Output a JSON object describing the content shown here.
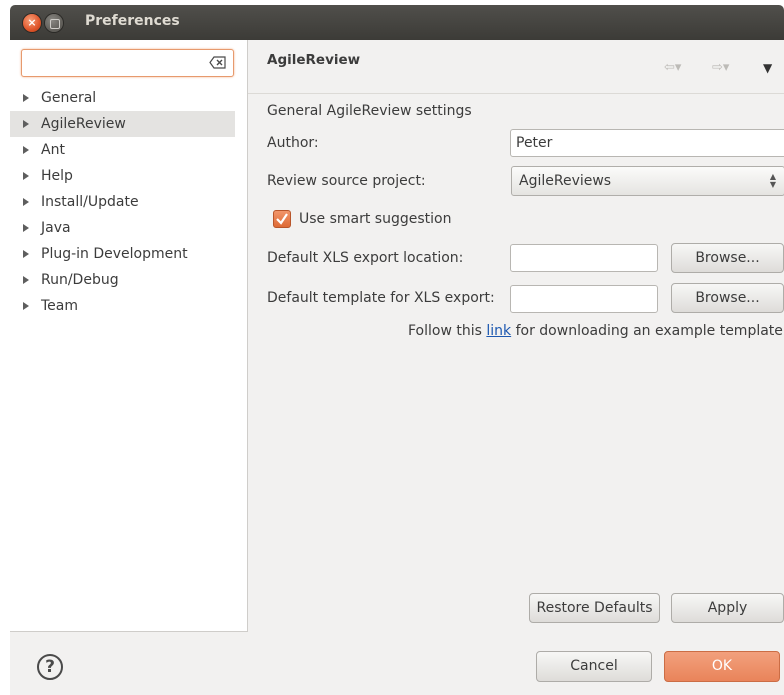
{
  "window": {
    "title": "Preferences"
  },
  "sidebar": {
    "filter_placeholder": "",
    "items": [
      {
        "label": "General"
      },
      {
        "label": "AgileReview"
      },
      {
        "label": "Ant"
      },
      {
        "label": "Help"
      },
      {
        "label": "Install/Update"
      },
      {
        "label": "Java"
      },
      {
        "label": "Plug-in Development"
      },
      {
        "label": "Run/Debug"
      },
      {
        "label": "Team"
      }
    ],
    "selected": "AgileReview"
  },
  "page": {
    "title": "AgileReview",
    "section_label": "General AgileReview settings",
    "author_label": "Author:",
    "author_value": "Peter",
    "source_project_label": "Review source project:",
    "source_project_value": "AgileReviews",
    "smart_suggestion_label": "Use smart suggestion",
    "smart_suggestion_checked": true,
    "xls_export_label": "Default XLS export location:",
    "xls_export_value": "",
    "xls_template_label": "Default template for XLS export:",
    "xls_template_value": "",
    "browse_label": "Browse...",
    "follow_prefix": "Follow this ",
    "link_text": "link",
    "follow_suffix": " for downloading an example template"
  },
  "buttons": {
    "restore_defaults": "Restore Defaults",
    "apply": "Apply",
    "cancel": "Cancel",
    "ok": "OK"
  },
  "icons": {
    "help": "question-icon",
    "close": "close-icon",
    "back": "back-arrow-icon",
    "forward": "forward-arrow-icon"
  },
  "colors": {
    "accent": "#e9845a",
    "link": "#1d58b0"
  }
}
